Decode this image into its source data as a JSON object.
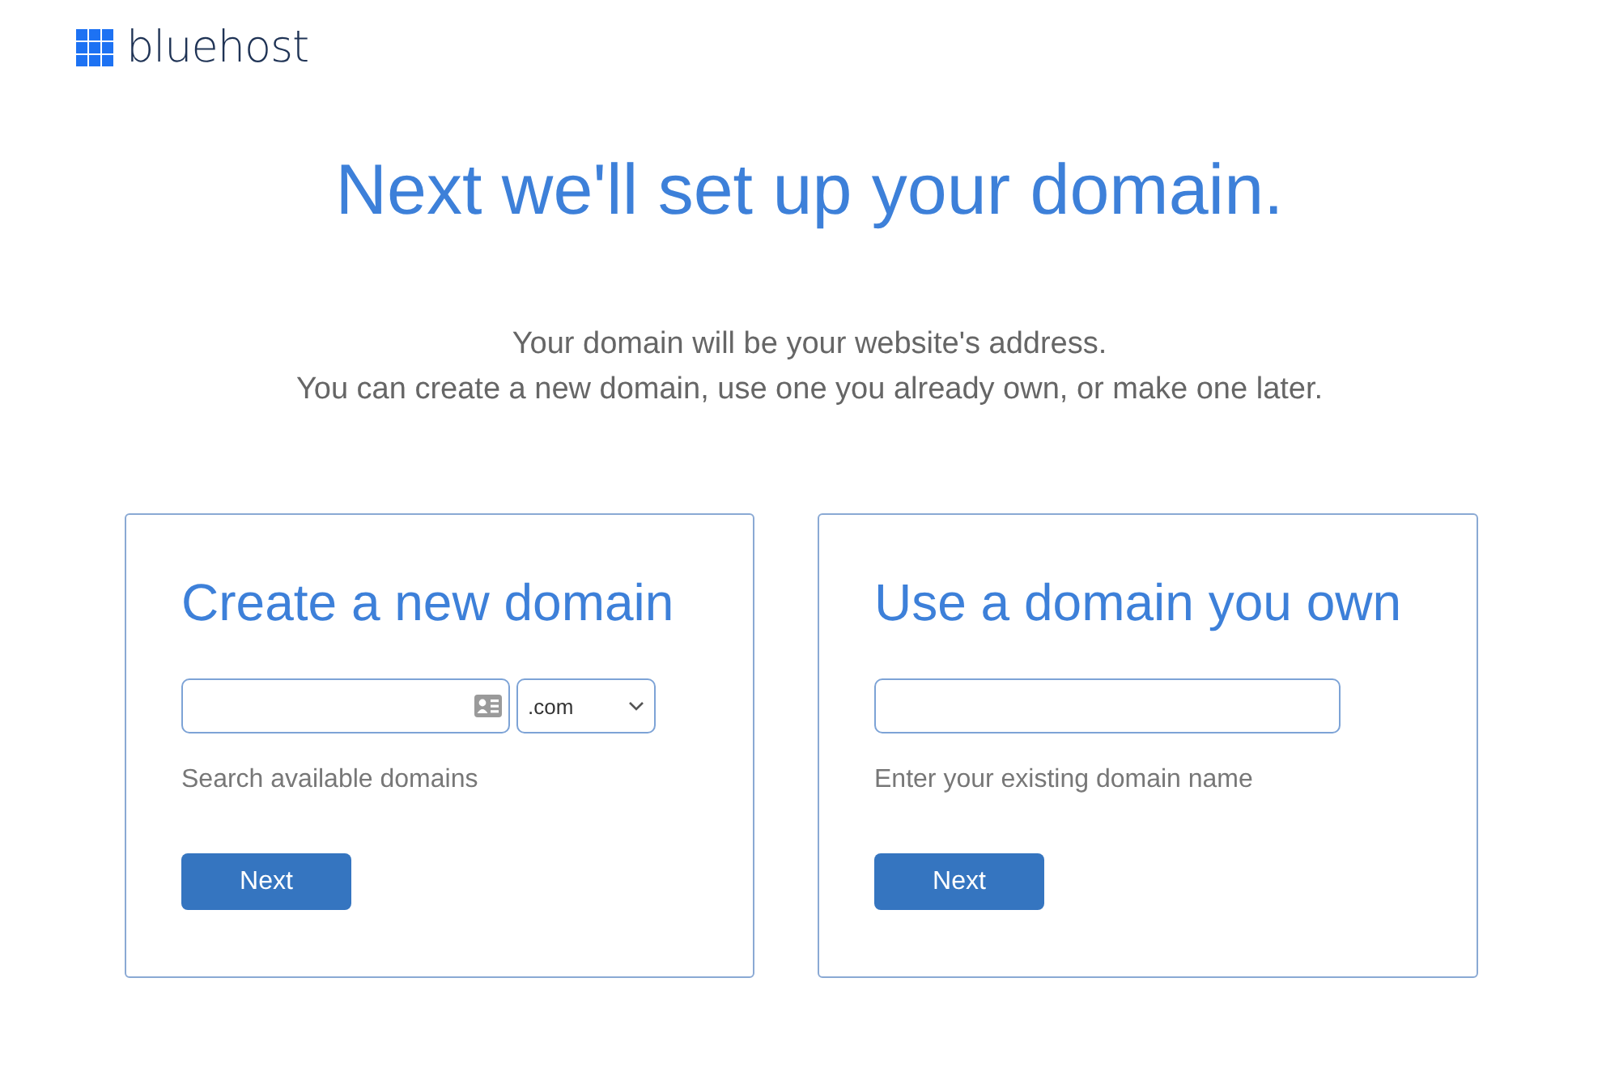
{
  "logo": {
    "text": "bluehost"
  },
  "heading": "Next we'll set up your domain.",
  "intro": [
    "Your domain will be your website's address.",
    "You can create a new domain, use one you already own, or make one later."
  ],
  "cards": [
    {
      "title": "Create a new domain",
      "tld": ".com",
      "caption": "Search available domains",
      "button": "Next"
    },
    {
      "title": "Use a domain you own",
      "caption": "Enter your existing domain name",
      "button": "Next"
    }
  ]
}
